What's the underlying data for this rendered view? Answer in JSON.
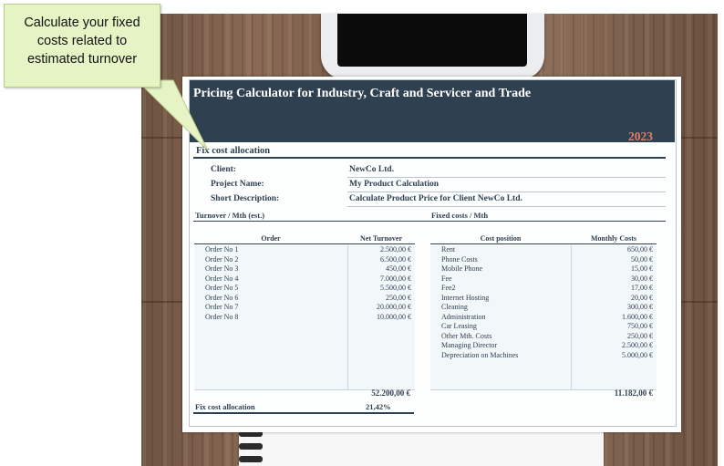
{
  "callout": {
    "lines": [
      "Calculate your fixed",
      "costs related to",
      "estimated turnover"
    ]
  },
  "sheet": {
    "title": "Pricing Calculator for Industry, Craft and Servicer and Trade",
    "year": "2023",
    "section_title": "Fix cost allocation",
    "info": [
      {
        "label": "Client:",
        "value": "NewCo Ltd."
      },
      {
        "label": "Project Name:",
        "value": "My Product Calculation"
      },
      {
        "label": "Short Description:",
        "value": "Calculate Product Price for Client NewCo Ltd."
      }
    ],
    "turnover_heading": "Turnover / Mth (est.)",
    "fixed_heading": "Fixed costs / Mth",
    "turnover_table": {
      "headers": [
        "Order",
        "Net Turnover"
      ],
      "rows": [
        [
          "Order No 1",
          "2.500,00 €"
        ],
        [
          "Order No 2",
          "6.500,00 €"
        ],
        [
          "Order No 3",
          "450,00 €"
        ],
        [
          "Order No 4",
          "7.000,00 €"
        ],
        [
          "Order No 5",
          "5.500,00 €"
        ],
        [
          "Order No 6",
          "250,00 €"
        ],
        [
          "Order No 7",
          "20.000,00 €"
        ],
        [
          "Order No 8",
          "10.000,00 €"
        ],
        [
          "",
          ""
        ],
        [
          "",
          ""
        ],
        [
          "",
          ""
        ],
        [
          "",
          ""
        ],
        [
          "",
          ""
        ],
        [
          "",
          ""
        ],
        [
          "",
          ""
        ]
      ],
      "total": "52.200,00 €"
    },
    "fixed_table": {
      "headers": [
        "Cost position",
        "Monthly Costs"
      ],
      "rows": [
        [
          "Rent",
          "650,00 €"
        ],
        [
          "Phone Costs",
          "50,00 €"
        ],
        [
          "Mobile Phone",
          "15,00 €"
        ],
        [
          "Fee",
          "30,00 €"
        ],
        [
          "Fee2",
          "17,00 €"
        ],
        [
          "Internet Hosting",
          "20,00 €"
        ],
        [
          "Cleaning",
          "300,00 €"
        ],
        [
          "Administration",
          "1.600,00 €"
        ],
        [
          "Car Leasing",
          "750,00 €"
        ],
        [
          "Other Mth. Costs",
          "250,00 €"
        ],
        [
          "Managing Director",
          "2.500,00 €"
        ],
        [
          "Depreciation on Machines",
          "5.000,00 €"
        ],
        [
          "",
          ""
        ],
        [
          "",
          ""
        ],
        [
          "",
          ""
        ]
      ],
      "total": "11.182,00 €"
    },
    "allocation_label": "Fix cost allocation",
    "allocation_value": "21,42%"
  }
}
